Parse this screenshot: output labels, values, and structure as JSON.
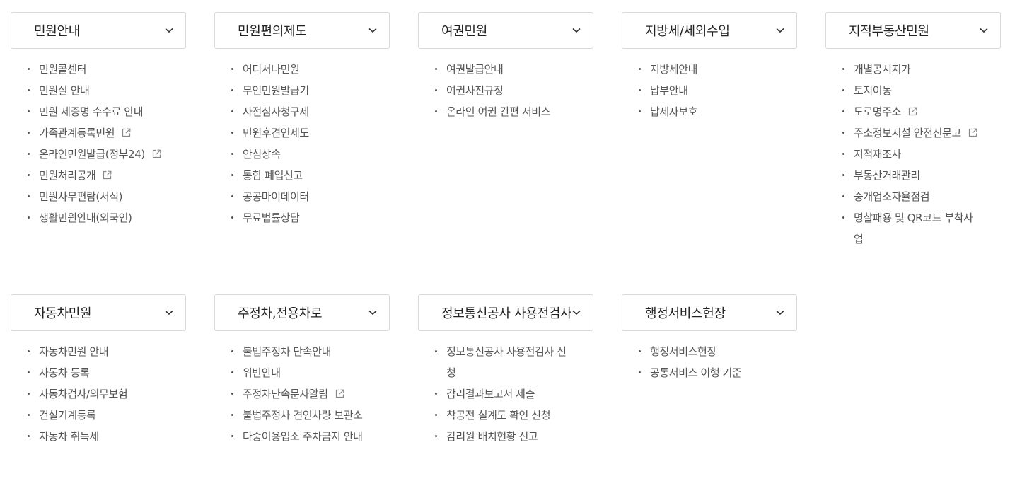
{
  "groups": [
    {
      "title": "민원안내",
      "items": [
        {
          "label": "민원콜센터"
        },
        {
          "label": "민원실 안내"
        },
        {
          "label": "민원 제증명 수수료 안내"
        },
        {
          "label": "가족관계등록민원",
          "external": true
        },
        {
          "label": "온라인민원발급(정부24)",
          "external": true
        },
        {
          "label": "민원처리공개",
          "external": true
        },
        {
          "label": "민원사무편람(서식)"
        },
        {
          "label": "생활민원안내(외국인)"
        }
      ]
    },
    {
      "title": "민원편의제도",
      "items": [
        {
          "label": "어디서나민원"
        },
        {
          "label": "무인민원발급기"
        },
        {
          "label": "사전심사청구제"
        },
        {
          "label": "민원후견인제도"
        },
        {
          "label": "안심상속"
        },
        {
          "label": "통합 폐업신고"
        },
        {
          "label": "공공마이데이터"
        },
        {
          "label": "무료법률상담"
        }
      ]
    },
    {
      "title": "여권민원",
      "items": [
        {
          "label": "여권발급안내"
        },
        {
          "label": "여권사진규정"
        },
        {
          "label": "온라인 여권 간편 서비스"
        }
      ]
    },
    {
      "title": "지방세/세외수입",
      "items": [
        {
          "label": "지방세안내"
        },
        {
          "label": "납부안내"
        },
        {
          "label": "납세자보호"
        }
      ]
    },
    {
      "title": "지적부동산민원",
      "items": [
        {
          "label": "개별공시지가"
        },
        {
          "label": "토지이동"
        },
        {
          "label": "도로명주소",
          "external": true
        },
        {
          "label": "주소정보시설 안전신문고",
          "external": true
        },
        {
          "label": "지적재조사"
        },
        {
          "label": "부동산거래관리"
        },
        {
          "label": "중개업소자율점검"
        },
        {
          "label": "명찰패용 및 QR코드 부착사업"
        }
      ]
    },
    {
      "title": "자동차민원",
      "items": [
        {
          "label": "자동차민원 안내"
        },
        {
          "label": "자동차 등록"
        },
        {
          "label": "자동차검사/의무보험"
        },
        {
          "label": "건설기계등록"
        },
        {
          "label": "자동차 취득세"
        }
      ]
    },
    {
      "title": "주정차,전용차로",
      "items": [
        {
          "label": "불법주정차 단속안내"
        },
        {
          "label": "위반안내"
        },
        {
          "label": "주정차단속문자알림",
          "external": true
        },
        {
          "label": "불법주정차 견인차량 보관소"
        },
        {
          "label": "다중이용업소 주차금지 안내"
        }
      ]
    },
    {
      "title": "정보통신공사 사용전검사",
      "items": [
        {
          "label": "정보통신공사 사용전검사 신청"
        },
        {
          "label": "감리결과보고서 제출"
        },
        {
          "label": "착공전 설계도 확인 신청"
        },
        {
          "label": "감리원 배치현황 신고"
        }
      ]
    },
    {
      "title": "행정서비스헌장",
      "items": [
        {
          "label": "행정서비스헌장"
        },
        {
          "label": "공통서비스 이행 기준"
        }
      ]
    }
  ]
}
